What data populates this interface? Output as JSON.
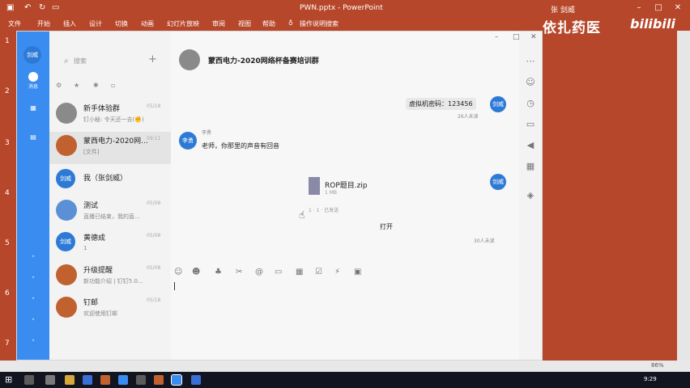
{
  "ppt": {
    "title": "PWN.pptx - PowerPoint",
    "user": "张 剑威",
    "tabs": [
      "文件",
      "开始",
      "插入",
      "设计",
      "切换",
      "动画",
      "幻灯片放映",
      "审阅",
      "视图",
      "帮助",
      "操作说明搜索"
    ],
    "slide_numbers": [
      "1",
      "2",
      "3",
      "4",
      "5",
      "6",
      "7"
    ],
    "zoom": "86%"
  },
  "watermark": {
    "text": "依扎药医",
    "bili": "bilibili"
  },
  "chat": {
    "search_placeholder": "搜索",
    "add": "+",
    "rail": {
      "top_avatar": "剑威",
      "messages_label": "消息"
    },
    "conversations": [
      {
        "name": "新手体验群",
        "preview": "钉小秘: 令天还一去(✊)",
        "time": "05/18"
      },
      {
        "name": "蒙西电力-2020网...",
        "preview": "[文件]",
        "time": "09:11"
      },
      {
        "name": "我（张剑威）",
        "preview": "",
        "time": ""
      },
      {
        "name": "测试",
        "preview": "直播已结束，我的直...",
        "time": "05/08"
      },
      {
        "name": "黄德成",
        "preview": "1",
        "time": "05/08"
      },
      {
        "name": "升级提醒",
        "preview": "新功能介绍 | 钉钉5.0...",
        "time": "05/08"
      },
      {
        "name": "钉邮",
        "preview": "欢迎使用钉邮",
        "time": "05/18"
      }
    ],
    "conv_avatars": [
      "",
      "",
      "剑威",
      "",
      "剑威",
      "",
      ""
    ],
    "group_title": "蒙西电力-2020网络杯备赛培训群",
    "messages": {
      "vm_password": "虚拟机密码：123456",
      "vm_unread": "26人未读",
      "sender_name": "李勇",
      "sender_avatar": "李勇",
      "teacher_msg": "老师，你那里的声音有回音",
      "file_name": "ROP题目.zip",
      "file_size": "1 MB",
      "file_note": "1 · 1 · 已发送",
      "open": "打开",
      "open_unread": "30人未读",
      "self_avatar": "剑威"
    }
  }
}
